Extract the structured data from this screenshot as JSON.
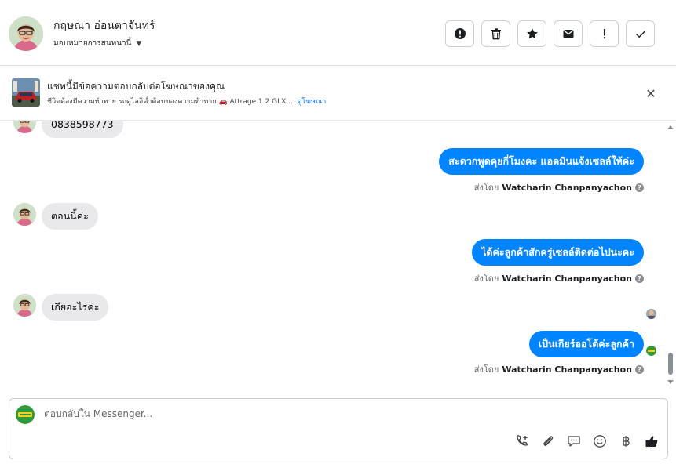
{
  "header": {
    "contact_name": "กฤษณา อ่อนตาจันทร์",
    "assign_label": "มอบหมายการสนทนานี้",
    "assign_caret": "▼"
  },
  "ad": {
    "title": "แชทนี้มีข้อความตอบกลับต่อโฆษณาของคุณ",
    "subtitle": "ชีวิตต้องมีความท้าทาย รถดูไลอิค่ำต้อบของความท้าทาย 🚗 Attrage 1.2 GLX ... ",
    "link": "ดูโฆษณา",
    "close": "✕"
  },
  "messages": [
    {
      "dir": "in",
      "text": "0838598773"
    },
    {
      "dir": "out",
      "text": "สะดวกพูดคุยกี่โมงคะ แอดมินแจ้งเซลล์ให้ค่ะ"
    },
    {
      "dir": "in",
      "text": "ตอนนี้ค่ะ"
    },
    {
      "dir": "out",
      "text": "ได้ค่ะลูกค้าสักครู่เซลล์ติดต่อไปนะคะ"
    },
    {
      "dir": "in",
      "text": "เกียอะไรค่ะ"
    },
    {
      "dir": "out",
      "text": "เป็นเกียร์ออโต้ค่ะลูกค้า"
    }
  ],
  "sent_by": {
    "prefix": "ส่งโดย",
    "name": "Watcharin Chanpanyachon",
    "help": "?"
  },
  "composer": {
    "placeholder": "ตอบกลับใน Messenger..."
  },
  "icons": {
    "header_actions": [
      "alert-circle-icon",
      "trash-icon",
      "star-icon",
      "envelope-icon",
      "exclamation-icon",
      "check-icon"
    ],
    "composer_tools": [
      "phone-add-icon",
      "paperclip-icon",
      "saved-reply-icon",
      "emoji-icon",
      "baht-icon",
      "thumbs-up-icon"
    ]
  },
  "colors": {
    "outgoing_bubble": "#0084ff",
    "incoming_bubble": "#e9e9eb",
    "link": "#1877f2"
  }
}
